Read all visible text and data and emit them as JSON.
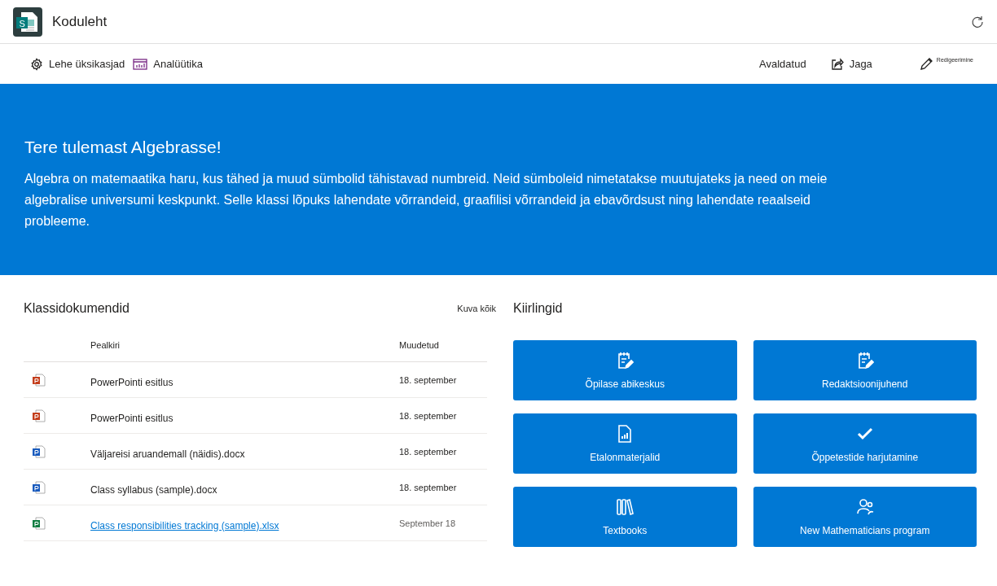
{
  "site": {
    "logo": "S",
    "title": "Koduleht"
  },
  "commands_left": [
    {
      "kind": "gear",
      "label": "Lehe üksikasjad"
    },
    {
      "kind": "chart",
      "label": "Analüütika"
    }
  ],
  "commands_right": [
    {
      "kind": "status",
      "label": "Avaldatud"
    },
    {
      "kind": "share",
      "label": "Jaga"
    },
    {
      "kind": "pencil",
      "label": "Redigeerimine"
    }
  ],
  "hero": {
    "title": "Tere tulemast Algebrasse!",
    "text": "Algebra on matemaatika haru, kus tähed ja muud sümbolid tähistavad numbreid. Neid sümboleid nimetatakse muutujateks ja need on meie algebralise universumi keskpunkt. Selle klassi lõpuks lahendate võrrandeid, graafilisi võrrandeid ja ebavõrdsust ning lahendate reaalseid probleeme."
  },
  "documents": {
    "title": "Klassidokumendid",
    "see_all": "Kuva kõik",
    "columns": [
      "Pealkiri",
      "Muudetud"
    ],
    "rows": [
      {
        "kind": "powerpoint",
        "name": "PowerPointi esitlus",
        "modified": "18. september",
        "link": false
      },
      {
        "kind": "powerpoint",
        "name": "PowerPointi esitlus",
        "modified": "18. september",
        "link": false
      },
      {
        "kind": "word",
        "name": "Väljareisi aruandemall (näidis).docx",
        "modified": "18. september",
        "link": false
      },
      {
        "kind": "word",
        "name": "Class syllabus (sample).docx",
        "modified": "18. september",
        "link": false
      },
      {
        "kind": "excel",
        "name": "Class responsibilities tracking (sample).xlsx",
        "modified": "September 18",
        "link": true
      }
    ]
  },
  "quick_links": {
    "title": "Kiirlingid",
    "items": [
      {
        "kind": "notepad",
        "label": "Õpilase abikeskus"
      },
      {
        "kind": "notepad",
        "label": "Redaktsioonijuhend"
      },
      {
        "kind": "report",
        "label": "Etalonmaterjalid"
      },
      {
        "kind": "check",
        "label": "Õppetestide harjutamine"
      },
      {
        "kind": "books",
        "label": "Textbooks"
      },
      {
        "kind": "people",
        "label": "New Mathematicians program"
      }
    ]
  }
}
